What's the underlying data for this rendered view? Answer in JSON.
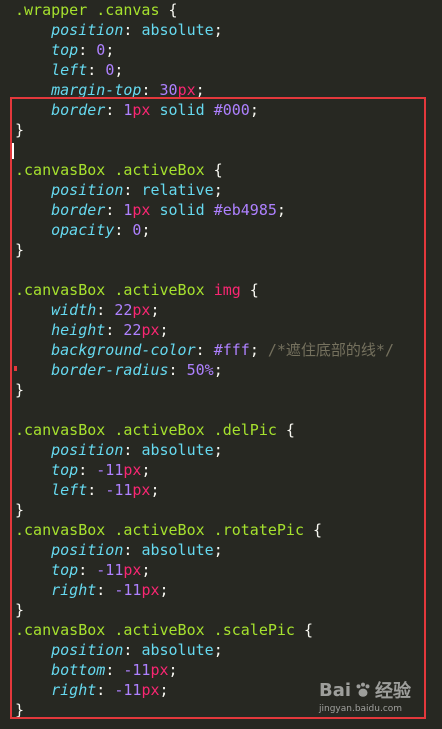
{
  "code_lines": [
    [
      {
        "t": ".wrapper .canvas",
        "c": "sel"
      },
      {
        "t": " {",
        "c": "brace"
      }
    ],
    [
      {
        "t": "    "
      },
      {
        "t": "position",
        "c": "prop"
      },
      {
        "t": ": ",
        "c": "punc"
      },
      {
        "t": "absolute",
        "c": "val"
      },
      {
        "t": ";",
        "c": "punc"
      }
    ],
    [
      {
        "t": "    "
      },
      {
        "t": "top",
        "c": "prop"
      },
      {
        "t": ": ",
        "c": "punc"
      },
      {
        "t": "0",
        "c": "num"
      },
      {
        "t": ";",
        "c": "punc"
      }
    ],
    [
      {
        "t": "    "
      },
      {
        "t": "left",
        "c": "prop"
      },
      {
        "t": ": ",
        "c": "punc"
      },
      {
        "t": "0",
        "c": "num"
      },
      {
        "t": ";",
        "c": "punc"
      }
    ],
    [
      {
        "t": "    "
      },
      {
        "t": "margin-top",
        "c": "prop"
      },
      {
        "t": ": ",
        "c": "punc"
      },
      {
        "t": "30",
        "c": "num"
      },
      {
        "t": "px",
        "c": "unit"
      },
      {
        "t": ";",
        "c": "punc"
      }
    ],
    [
      {
        "t": "    "
      },
      {
        "t": "border",
        "c": "prop"
      },
      {
        "t": ": ",
        "c": "punc"
      },
      {
        "t": "1",
        "c": "num"
      },
      {
        "t": "px",
        "c": "unit"
      },
      {
        "t": " solid ",
        "c": "val"
      },
      {
        "t": "#000",
        "c": "num"
      },
      {
        "t": ";",
        "c": "punc"
      }
    ],
    [
      {
        "t": "}",
        "c": "brace"
      }
    ],
    [
      {
        "t": ""
      }
    ],
    [
      {
        "t": ".canvasBox .activeBox",
        "c": "sel"
      },
      {
        "t": " {",
        "c": "brace"
      }
    ],
    [
      {
        "t": "    "
      },
      {
        "t": "position",
        "c": "prop"
      },
      {
        "t": ": ",
        "c": "punc"
      },
      {
        "t": "relative",
        "c": "val"
      },
      {
        "t": ";",
        "c": "punc"
      }
    ],
    [
      {
        "t": "    "
      },
      {
        "t": "border",
        "c": "prop"
      },
      {
        "t": ": ",
        "c": "punc"
      },
      {
        "t": "1",
        "c": "num"
      },
      {
        "t": "px",
        "c": "unit"
      },
      {
        "t": " solid ",
        "c": "val"
      },
      {
        "t": "#eb4985",
        "c": "num"
      },
      {
        "t": ";",
        "c": "punc"
      }
    ],
    [
      {
        "t": "    "
      },
      {
        "t": "opacity",
        "c": "prop"
      },
      {
        "t": ": ",
        "c": "punc"
      },
      {
        "t": "0",
        "c": "num"
      },
      {
        "t": ";",
        "c": "punc"
      }
    ],
    [
      {
        "t": "}",
        "c": "brace"
      }
    ],
    [
      {
        "t": ""
      }
    ],
    [
      {
        "t": ".canvasBox .activeBox ",
        "c": "sel"
      },
      {
        "t": "img",
        "c": "tag"
      },
      {
        "t": " {",
        "c": "brace"
      }
    ],
    [
      {
        "t": "    "
      },
      {
        "t": "width",
        "c": "prop"
      },
      {
        "t": ": ",
        "c": "punc"
      },
      {
        "t": "22",
        "c": "num"
      },
      {
        "t": "px",
        "c": "unit"
      },
      {
        "t": ";",
        "c": "punc"
      }
    ],
    [
      {
        "t": "    "
      },
      {
        "t": "height",
        "c": "prop"
      },
      {
        "t": ": ",
        "c": "punc"
      },
      {
        "t": "22",
        "c": "num"
      },
      {
        "t": "px",
        "c": "unit"
      },
      {
        "t": ";",
        "c": "punc"
      }
    ],
    [
      {
        "t": "    "
      },
      {
        "t": "background-color",
        "c": "prop"
      },
      {
        "t": ": ",
        "c": "punc"
      },
      {
        "t": "#fff",
        "c": "num"
      },
      {
        "t": "; ",
        "c": "punc"
      },
      {
        "t": "/*遮住底部的线*/",
        "c": "cmt"
      }
    ],
    [
      {
        "t": "    "
      },
      {
        "t": "border-radius",
        "c": "prop"
      },
      {
        "t": ": ",
        "c": "punc"
      },
      {
        "t": "50%",
        "c": "num"
      },
      {
        "t": ";",
        "c": "punc"
      }
    ],
    [
      {
        "t": "}",
        "c": "brace"
      }
    ],
    [
      {
        "t": ""
      }
    ],
    [
      {
        "t": ".canvasBox .activeBox .delPic",
        "c": "sel"
      },
      {
        "t": " {",
        "c": "brace"
      }
    ],
    [
      {
        "t": "    "
      },
      {
        "t": "position",
        "c": "prop"
      },
      {
        "t": ": ",
        "c": "punc"
      },
      {
        "t": "absolute",
        "c": "val"
      },
      {
        "t": ";",
        "c": "punc"
      }
    ],
    [
      {
        "t": "    "
      },
      {
        "t": "top",
        "c": "prop"
      },
      {
        "t": ": ",
        "c": "punc"
      },
      {
        "t": "-11",
        "c": "num"
      },
      {
        "t": "px",
        "c": "unit"
      },
      {
        "t": ";",
        "c": "punc"
      }
    ],
    [
      {
        "t": "    "
      },
      {
        "t": "left",
        "c": "prop"
      },
      {
        "t": ": ",
        "c": "punc"
      },
      {
        "t": "-11",
        "c": "num"
      },
      {
        "t": "px",
        "c": "unit"
      },
      {
        "t": ";",
        "c": "punc"
      }
    ],
    [
      {
        "t": "}",
        "c": "brace"
      }
    ],
    [
      {
        "t": ".canvasBox .activeBox .rotatePic",
        "c": "sel"
      },
      {
        "t": " {",
        "c": "brace"
      }
    ],
    [
      {
        "t": "    "
      },
      {
        "t": "position",
        "c": "prop"
      },
      {
        "t": ": ",
        "c": "punc"
      },
      {
        "t": "absolute",
        "c": "val"
      },
      {
        "t": ";",
        "c": "punc"
      }
    ],
    [
      {
        "t": "    "
      },
      {
        "t": "top",
        "c": "prop"
      },
      {
        "t": ": ",
        "c": "punc"
      },
      {
        "t": "-11",
        "c": "num"
      },
      {
        "t": "px",
        "c": "unit"
      },
      {
        "t": ";",
        "c": "punc"
      }
    ],
    [
      {
        "t": "    "
      },
      {
        "t": "right",
        "c": "prop"
      },
      {
        "t": ": ",
        "c": "punc"
      },
      {
        "t": "-11",
        "c": "num"
      },
      {
        "t": "px",
        "c": "unit"
      },
      {
        "t": ";",
        "c": "punc"
      }
    ],
    [
      {
        "t": "}",
        "c": "brace"
      }
    ],
    [
      {
        "t": ".canvasBox .activeBox .scalePic",
        "c": "sel"
      },
      {
        "t": " {",
        "c": "brace"
      }
    ],
    [
      {
        "t": "    "
      },
      {
        "t": "position",
        "c": "prop"
      },
      {
        "t": ": ",
        "c": "punc"
      },
      {
        "t": "absolute",
        "c": "val"
      },
      {
        "t": ";",
        "c": "punc"
      }
    ],
    [
      {
        "t": "    "
      },
      {
        "t": "bottom",
        "c": "prop"
      },
      {
        "t": ": ",
        "c": "punc"
      },
      {
        "t": "-11",
        "c": "num"
      },
      {
        "t": "px",
        "c": "unit"
      },
      {
        "t": ";",
        "c": "punc"
      }
    ],
    [
      {
        "t": "    "
      },
      {
        "t": "right",
        "c": "prop"
      },
      {
        "t": ": ",
        "c": "punc"
      },
      {
        "t": "-11",
        "c": "num"
      },
      {
        "t": "px",
        "c": "unit"
      },
      {
        "t": ";",
        "c": "punc"
      }
    ],
    [
      {
        "t": "}",
        "c": "brace"
      }
    ]
  ],
  "colors": {
    "background": "#272822",
    "selector": "#a6e22e",
    "property": "#66d9ef",
    "number": "#ae81ff",
    "unit": "#f92672",
    "comment": "#75715e",
    "highlight_border": "#e3383c"
  },
  "watermark": {
    "brand": "Bai",
    "brand_suffix": "经验",
    "url": "jingyan.baidu.com",
    "icon": "paw-icon"
  }
}
